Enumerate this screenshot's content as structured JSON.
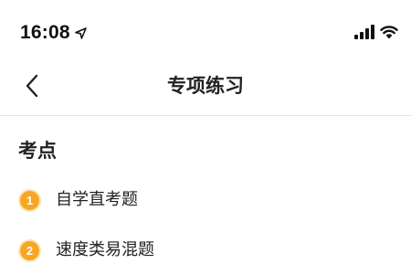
{
  "status_bar": {
    "time": "16:08",
    "icons": [
      "location-arrow-icon",
      "cellular-signal-icon",
      "wifi-icon"
    ]
  },
  "nav": {
    "back_icon": "chevron-left-icon",
    "title": "专项练习"
  },
  "section": {
    "title": "考点"
  },
  "items": [
    {
      "index": "1",
      "label": "自学直考题"
    },
    {
      "index": "2",
      "label": "速度类易混题"
    }
  ],
  "colors": {
    "accent": "#f5a623",
    "accent_halo": "#fde4b3",
    "text": "#222222",
    "divider": "#e5e5e5",
    "background": "#ffffff"
  }
}
